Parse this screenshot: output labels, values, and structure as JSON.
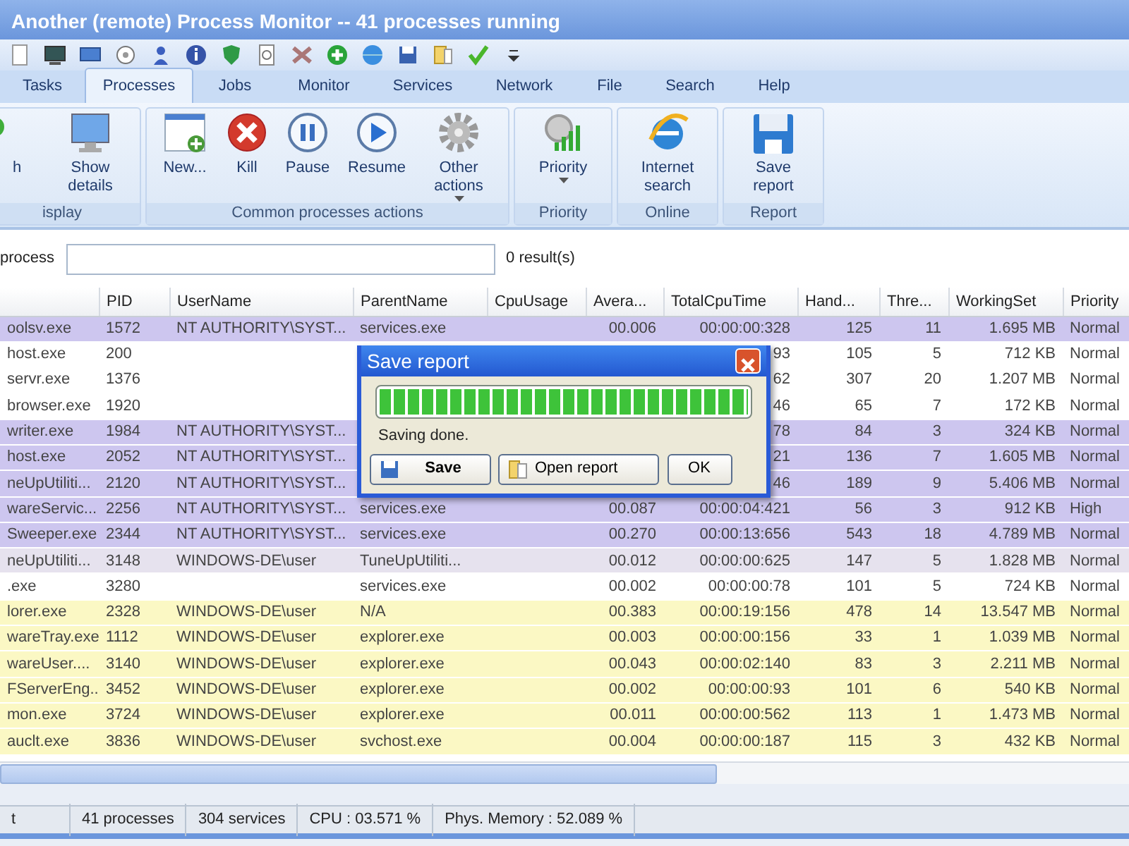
{
  "window": {
    "title": "Another (remote) Process Monitor -- 41 processes running"
  },
  "tabs": [
    {
      "label": "Tasks",
      "selected": false
    },
    {
      "label": "Processes",
      "selected": true
    },
    {
      "label": "Jobs",
      "selected": false
    },
    {
      "label": "Monitor",
      "selected": false
    },
    {
      "label": "Services",
      "selected": false
    },
    {
      "label": "Network",
      "selected": false
    },
    {
      "label": "File",
      "selected": false
    },
    {
      "label": "Search",
      "selected": false
    },
    {
      "label": "Help",
      "selected": false
    }
  ],
  "ribbon_groups": [
    {
      "label": "isplay",
      "buttons": [
        {
          "label": "h",
          "dropdown": false
        },
        {
          "label": "Show details",
          "dropdown": false
        }
      ]
    },
    {
      "label": "Common processes actions",
      "buttons": [
        {
          "label": "New...",
          "dropdown": false
        },
        {
          "label": "Kill",
          "dropdown": false
        },
        {
          "label": "Pause",
          "dropdown": false
        },
        {
          "label": "Resume",
          "dropdown": false
        },
        {
          "label": "Other actions",
          "dropdown": true
        }
      ]
    },
    {
      "label": "Priority",
      "buttons": [
        {
          "label": "Priority",
          "dropdown": true
        }
      ]
    },
    {
      "label": "Online",
      "buttons": [
        {
          "label": "Internet search",
          "dropdown": false
        }
      ]
    },
    {
      "label": "Report",
      "buttons": [
        {
          "label": "Save report",
          "dropdown": false
        }
      ]
    }
  ],
  "search": {
    "label": "process",
    "results": "0 result(s)"
  },
  "table": {
    "columns": [
      "",
      "PID",
      "UserName",
      "ParentName",
      "CpuUsage",
      "Avera...",
      "TotalCpuTime",
      "Hand...",
      "Thre...",
      "WorkingSet",
      "Priority"
    ],
    "rows": [
      {
        "color": "#cdc6ef",
        "cells": [
          "oolsv.exe",
          "1572",
          "NT AUTHORITY\\SYST...",
          "services.exe",
          "",
          "00.006",
          "00:00:00:328",
          "125",
          "11",
          "1.695 MB",
          "Normal"
        ]
      },
      {
        "color": "#ffffff",
        "cells": [
          "host.exe",
          "200",
          "",
          "",
          "",
          "",
          "93",
          "105",
          "5",
          "712 KB",
          "Normal"
        ]
      },
      {
        "color": "#ffffff",
        "cells": [
          "servr.exe",
          "1376",
          "",
          "",
          "",
          "",
          "62",
          "307",
          "20",
          "1.207 MB",
          "Normal"
        ]
      },
      {
        "color": "#ffffff",
        "cells": [
          "browser.exe",
          "1920",
          "",
          "",
          "",
          "",
          "46",
          "65",
          "7",
          "172 KB",
          "Normal"
        ]
      },
      {
        "color": "#cdc6ef",
        "cells": [
          "writer.exe",
          "1984",
          "NT AUTHORITY\\SYST...",
          "",
          "",
          "",
          "78",
          "84",
          "3",
          "324 KB",
          "Normal"
        ]
      },
      {
        "color": "#cdc6ef",
        "cells": [
          "host.exe",
          "2052",
          "NT AUTHORITY\\SYST...",
          "",
          "",
          "",
          "21",
          "136",
          "7",
          "1.605 MB",
          "Normal"
        ]
      },
      {
        "color": "#cdc6ef",
        "cells": [
          "neUpUtiliti...",
          "2120",
          "NT AUTHORITY\\SYST...",
          "",
          "",
          "",
          "46",
          "189",
          "9",
          "5.406 MB",
          "Normal"
        ]
      },
      {
        "color": "#cdc6ef",
        "cells": [
          "wareServic...",
          "2256",
          "NT AUTHORITY\\SYST...",
          "services.exe",
          "",
          "00.087",
          "00:00:04:421",
          "56",
          "3",
          "912 KB",
          "High"
        ]
      },
      {
        "color": "#cdc6ef",
        "cells": [
          "Sweeper.exe",
          "2344",
          "NT AUTHORITY\\SYST...",
          "services.exe",
          "",
          "00.270",
          "00:00:13:656",
          "543",
          "18",
          "4.789 MB",
          "Normal"
        ]
      },
      {
        "color": "#e6e2ee",
        "cells": [
          "neUpUtiliti...",
          "3148",
          "WINDOWS-DE\\user",
          "TuneUpUtiliti...",
          "",
          "00.012",
          "00:00:00:625",
          "147",
          "5",
          "1.828 MB",
          "Normal"
        ]
      },
      {
        "color": "#ffffff",
        "cells": [
          ".exe",
          "3280",
          "",
          "services.exe",
          "",
          "00.002",
          "00:00:00:78",
          "101",
          "5",
          "724 KB",
          "Normal"
        ]
      },
      {
        "color": "#fbf8c4",
        "cells": [
          "lorer.exe",
          "2328",
          "WINDOWS-DE\\user",
          "N/A",
          "",
          "00.383",
          "00:00:19:156",
          "478",
          "14",
          "13.547 MB",
          "Normal"
        ]
      },
      {
        "color": "#fbf8c4",
        "cells": [
          "wareTray.exe",
          "1112",
          "WINDOWS-DE\\user",
          "explorer.exe",
          "",
          "00.003",
          "00:00:00:156",
          "33",
          "1",
          "1.039 MB",
          "Normal"
        ]
      },
      {
        "color": "#fbf8c4",
        "cells": [
          "wareUser....",
          "3140",
          "WINDOWS-DE\\user",
          "explorer.exe",
          "",
          "00.043",
          "00:00:02:140",
          "83",
          "3",
          "2.211 MB",
          "Normal"
        ]
      },
      {
        "color": "#fbf8c4",
        "cells": [
          "FServerEng...",
          "3452",
          "WINDOWS-DE\\user",
          "explorer.exe",
          "",
          "00.002",
          "00:00:00:93",
          "101",
          "6",
          "540 KB",
          "Normal"
        ]
      },
      {
        "color": "#fbf8c4",
        "cells": [
          "mon.exe",
          "3724",
          "WINDOWS-DE\\user",
          "explorer.exe",
          "",
          "00.011",
          "00:00:00:562",
          "113",
          "1",
          "1.473 MB",
          "Normal"
        ]
      },
      {
        "color": "#fbf8c4",
        "cells": [
          "auclt.exe",
          "3836",
          "WINDOWS-DE\\user",
          "svchost.exe",
          "",
          "00.004",
          "00:00:00:187",
          "115",
          "3",
          "432 KB",
          "Normal"
        ]
      }
    ]
  },
  "dialog": {
    "title": "Save report",
    "level": 1,
    "message": "Saving done.",
    "buttons": [
      {
        "label": "Save",
        "kind": "save"
      },
      {
        "label": "Open report",
        "kind": "open"
      },
      {
        "label": "OK",
        "kind": "plain"
      }
    ]
  },
  "status_bar": [
    "t",
    "41 processes",
    "304 services",
    "CPU : 03.571 %",
    "Phys. Memory : 52.089 %"
  ]
}
